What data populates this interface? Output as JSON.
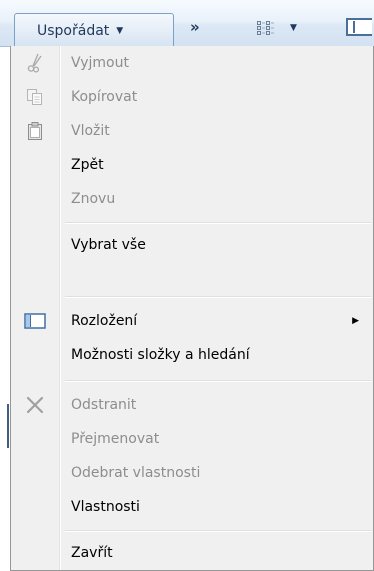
{
  "toolbar": {
    "organize_label": "Uspořádat",
    "more_label": "»"
  },
  "menu": {
    "items": [
      {
        "label": "Vyjmout",
        "icon": "scissors-icon",
        "disabled": true
      },
      {
        "label": "Kopírovat",
        "icon": "copy-icon",
        "disabled": true
      },
      {
        "label": "Vložit",
        "icon": "clipboard-icon",
        "disabled": true
      },
      {
        "label": "Zpět",
        "disabled": false
      },
      {
        "label": "Znovu",
        "disabled": true
      },
      {
        "label": "Vybrat vše",
        "disabled": false
      },
      {
        "label": "Rozložení",
        "icon": "layout-icon",
        "disabled": false,
        "submenu": true
      },
      {
        "label": "Možnosti složky a hledání",
        "disabled": false
      },
      {
        "label": "Odstranit",
        "icon": "delete-icon",
        "disabled": true
      },
      {
        "label": "Přejmenovat",
        "disabled": true
      },
      {
        "label": "Odebrat vlastnosti",
        "disabled": true
      },
      {
        "label": "Vlastnosti",
        "disabled": false
      },
      {
        "label": "Zavřít",
        "disabled": false
      }
    ]
  }
}
